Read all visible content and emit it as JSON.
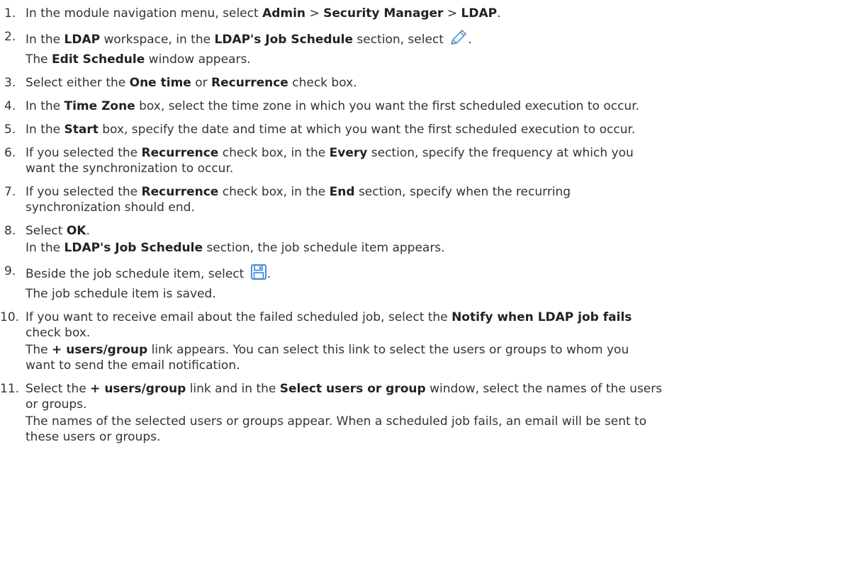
{
  "steps": [
    {
      "num": "1.",
      "t0": "In the module navigation menu, select ",
      "b0": "Admin",
      "t1": " > ",
      "b1": "Security Manager",
      "t2": " > ",
      "b2": "LDAP",
      "t3": "."
    },
    {
      "num": "2.",
      "t0": "In the ",
      "b0": "LDAP",
      "t1": " workspace, in the ",
      "b1": "LDAP's Job Schedule",
      "t2": " section, select ",
      "t3": ".",
      "icon": "pencil-icon",
      "icon_color": "#5b9bd5",
      "r0": "The ",
      "rb0": "Edit Schedule",
      "r1": " window appears."
    },
    {
      "num": "3.",
      "t0": "Select either the ",
      "b0": "One time",
      "t1": " or ",
      "b1": "Recurrence",
      "t2": " check box."
    },
    {
      "num": "4.",
      "t0": "In the ",
      "b0": "Time Zone",
      "t1": " box, select the time zone in which you want the first scheduled execution to occur."
    },
    {
      "num": "5.",
      "t0": "In the ",
      "b0": "Start",
      "t1": " box, specify the date and time at which you want the first scheduled execution to occur."
    },
    {
      "num": "6.",
      "t0": "If you selected the ",
      "b0": "Recurrence",
      "t1": " check box, in the ",
      "b1": "Every",
      "t2": " section, specify the frequency at which you",
      "l2": "want the synchronization to occur."
    },
    {
      "num": "7.",
      "t0": "If you selected the ",
      "b0": "Recurrence",
      "t1": " check box, in the ",
      "b1": "End",
      "t2": " section, specify when the recurring",
      "l2": "synchronization should end."
    },
    {
      "num": "8.",
      "t0": "Select ",
      "b0": "OK",
      "t1": ".",
      "r0": "In the ",
      "rb0": "LDAP's Job Schedule",
      "r1": " section, the job schedule item appears."
    },
    {
      "num": "9.",
      "t0": "Beside the job schedule item, select ",
      "t1": ".",
      "icon": "save-icon",
      "icon_color": "#4a90d9",
      "r0": "The job schedule item is saved."
    },
    {
      "num": "10.",
      "t0": "If you want to receive email about the failed scheduled job, select the ",
      "b0": "Notify when LDAP job fails",
      "l2": "check box.",
      "r0": "The ",
      "rb0": "+ users/group",
      "r1": " link appears. You can select this link to select the users or groups to whom you",
      "r2": "want to send the email notification."
    },
    {
      "num": "11.",
      "t0": "Select the ",
      "b0": "+ users/group",
      "t1": " link and in the ",
      "b1": "Select users or group",
      "t2": " window, select the names of the users",
      "l2": "or groups.",
      "r0": "The names of the selected users or groups appear. When a scheduled job fails, an email will be sent to",
      "r1": "these users or groups."
    }
  ]
}
